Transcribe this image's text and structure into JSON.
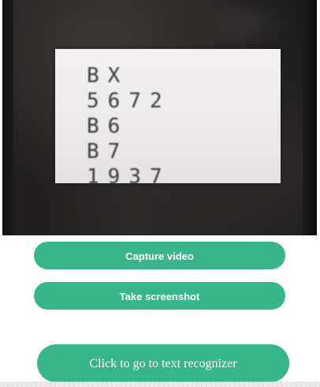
{
  "video": {
    "label_lines": [
      "BX",
      "5672",
      "B6",
      "B7",
      "1937"
    ]
  },
  "buttons": {
    "capture_label": "Capture video",
    "screenshot_label": "Take screenshot",
    "recognizer_label": "Click to go to text recognizer"
  },
  "colors": {
    "button_bg": "#36b689",
    "button_text": "#ffffff"
  }
}
